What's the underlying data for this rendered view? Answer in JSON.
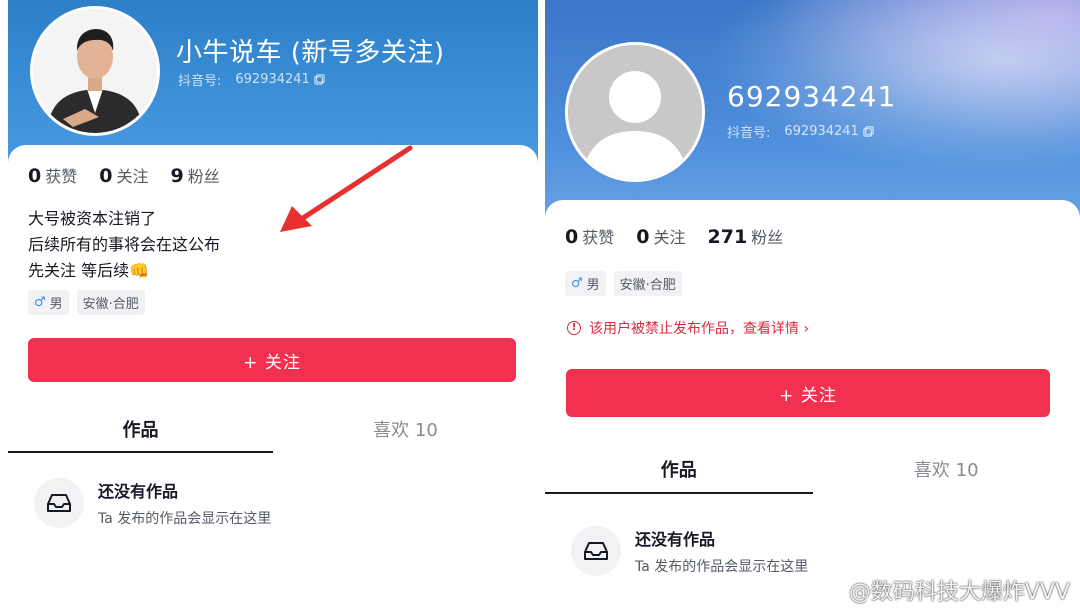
{
  "left": {
    "nickname": "小牛说车 (新号多关注)",
    "id_label": "抖音号:",
    "id_value": "692934241",
    "stats": [
      {
        "num": "0",
        "label": "获赞"
      },
      {
        "num": "0",
        "label": "关注"
      },
      {
        "num": "9",
        "label": "粉丝"
      }
    ],
    "bio": [
      "大号被资本注销了",
      "后续所有的事将会在这公布",
      "先关注 等后续👊"
    ],
    "gender": "男",
    "location": "安徽·合肥",
    "follow_label": "+ 关注",
    "tabs": [
      {
        "label": "作品"
      },
      {
        "label": "喜欢 10"
      }
    ],
    "empty_title": "还没有作品",
    "empty_sub": "Ta 发布的作品会显示在这里"
  },
  "right": {
    "nickname": "692934241",
    "id_label": "抖音号:",
    "id_value": "692934241",
    "stats": [
      {
        "num": "0",
        "label": "获赞"
      },
      {
        "num": "0",
        "label": "关注"
      },
      {
        "num": "271",
        "label": "粉丝"
      }
    ],
    "gender": "男",
    "location": "安徽·合肥",
    "ban_notice": "该用户被禁止发布作品，查看详情 ›",
    "follow_label": "+ 关注",
    "tabs": [
      {
        "label": "作品"
      },
      {
        "label": "喜欢 10"
      }
    ],
    "empty_title": "还没有作品",
    "empty_sub": "Ta 发布的作品会显示在这里"
  },
  "watermark": "@数码科技大爆炸VVV",
  "icons": {
    "copy": "copy-icon",
    "gender": "male-icon",
    "warning": "warning-icon",
    "empty": "inbox-icon",
    "annotation": "red-arrow-icon",
    "watermark_logo": "weibo-icon"
  },
  "colors": {
    "accent": "#f2304f",
    "warning_text": "#e0283f",
    "header_blue": "#3b8fd6"
  }
}
